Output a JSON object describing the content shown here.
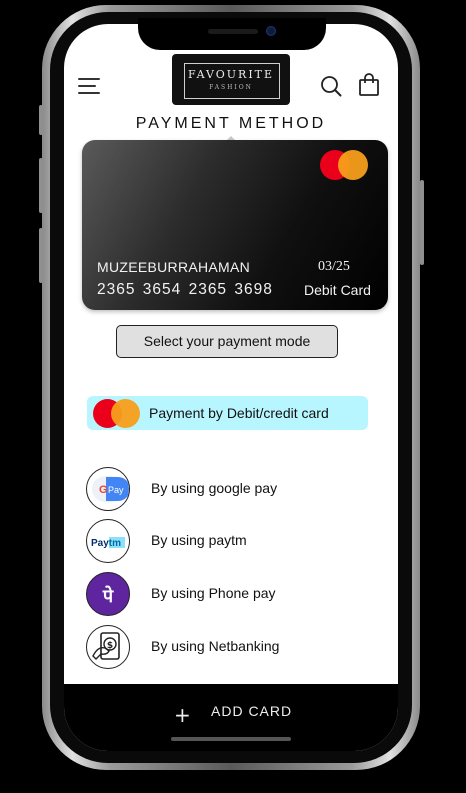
{
  "header": {
    "logo_title": "FAVOURITE",
    "logo_subtitle": "FASHION",
    "menu_icon": "hamburger-icon",
    "search_icon": "search-icon",
    "bag_icon": "shopping-bag-icon"
  },
  "page_title": "PAYMENT METHOD",
  "card": {
    "holder": "MUZEEBURRAHAMAN",
    "number": "2365 3654 2365 3698",
    "expiry": "03/25",
    "type": "Debit Card",
    "brand_icon": "mastercard-icon"
  },
  "select_mode_label": "Select your payment mode",
  "debit_option": {
    "label": "Payment by Debit/credit card",
    "icon": "mastercard-icon",
    "highlight_color": "#b8f6ff"
  },
  "payment_options": [
    {
      "label": "By using google pay",
      "icon": "google-pay-icon",
      "icon_text": "Pay"
    },
    {
      "label": "By using paytm",
      "icon": "paytm-icon",
      "icon_text": "Paytm"
    },
    {
      "label": "By using Phone pay",
      "icon": "phonepe-icon",
      "icon_text": "पे"
    },
    {
      "label": "By using Netbanking",
      "icon": "netbanking-icon",
      "icon_text": "$"
    }
  ],
  "add_card": {
    "label": "ADD CARD",
    "icon": "plus-icon"
  },
  "colors": {
    "mastercard_red": "#eb001b",
    "mastercard_orange": "#f79e1b",
    "phonepe_purple": "#5f259f",
    "paytm_blue": "#00baf2",
    "paytm_navy": "#002e6e"
  }
}
